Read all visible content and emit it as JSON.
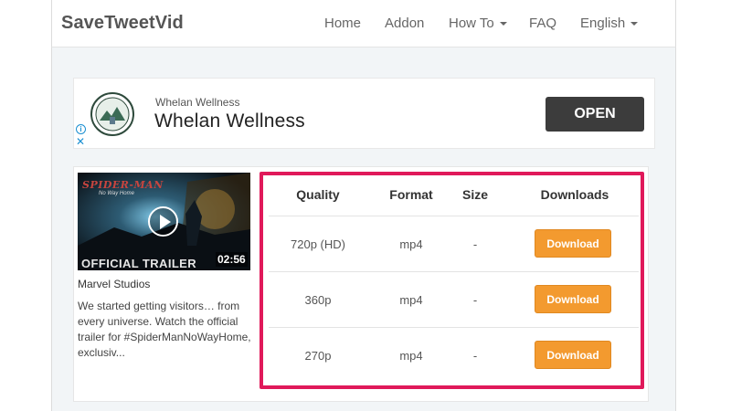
{
  "navbar": {
    "brand": "SaveTweetVid",
    "items": [
      {
        "label": "Home",
        "dropdown": false
      },
      {
        "label": "Addon",
        "dropdown": false
      },
      {
        "label": "How To",
        "dropdown": true
      },
      {
        "label": "FAQ",
        "dropdown": false
      },
      {
        "label": "English",
        "dropdown": true
      }
    ]
  },
  "ad": {
    "advertiser_small": "Whelan Wellness",
    "advertiser_title": "Whelan Wellness",
    "open_label": "OPEN",
    "adchoices_glyph": "i",
    "close_glyph": "✕"
  },
  "video": {
    "thumbnail_title": "SPIDER-MAN",
    "thumbnail_subtitle": "No Way Home",
    "thumbnail_caption": "OFFICIAL TRAILER",
    "duration": "02:56",
    "channel": "Marvel Studios",
    "description": "We started getting visitors… from every universe. Watch the official trailer for #SpiderManNoWayHome, exclusiv..."
  },
  "downloads": {
    "headers": {
      "quality": "Quality",
      "format": "Format",
      "size": "Size",
      "downloads": "Downloads"
    },
    "rows": [
      {
        "quality": "720p (HD)",
        "format": "mp4",
        "size": "-",
        "button": "Download"
      },
      {
        "quality": "360p",
        "format": "mp4",
        "size": "-",
        "button": "Download"
      },
      {
        "quality": "270p",
        "format": "mp4",
        "size": "-",
        "button": "Download"
      }
    ]
  },
  "colors": {
    "highlight_border": "#e0195a",
    "download_button": "#f39a2f",
    "open_button": "#3c3c3c",
    "adchoices": "#1a8fd1"
  }
}
